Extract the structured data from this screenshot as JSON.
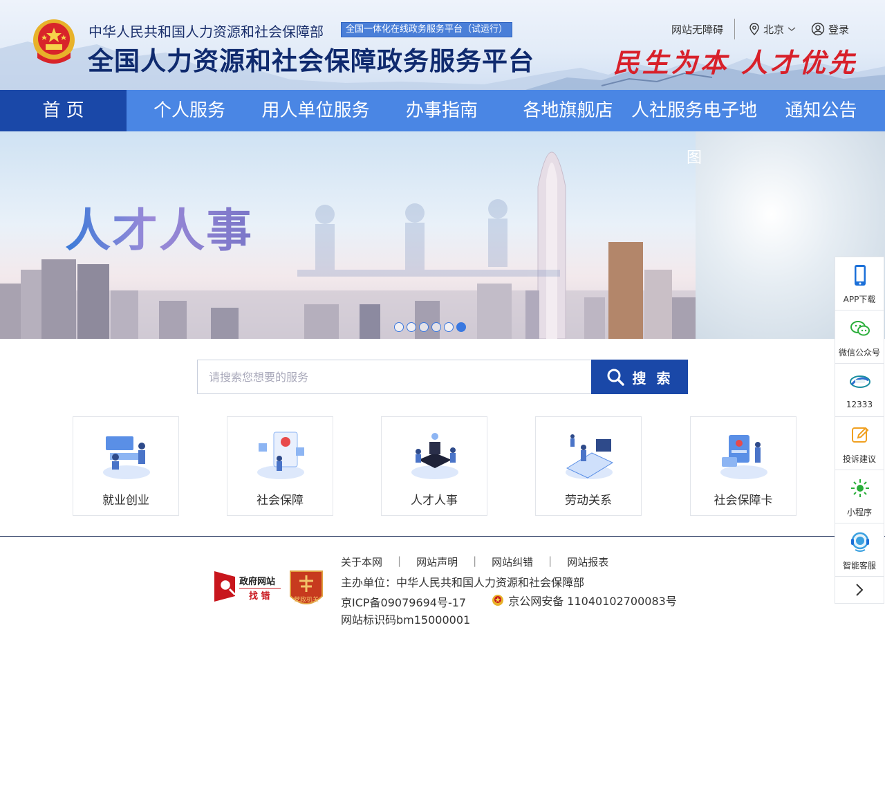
{
  "header": {
    "ministry": "中华人民共和国人力资源和社会保障部",
    "trial_badge": "全国一体化在线政务服务平台（试运行）",
    "platform": "全国人力资源和社会保障政务服务平台",
    "accessibility": "网站无障碍",
    "location": "北京",
    "login": "登录",
    "slogan": "民生为本 人才优先"
  },
  "nav": [
    {
      "label": "首 页",
      "active": true
    },
    {
      "label": "个人服务"
    },
    {
      "label": "用人单位服务"
    },
    {
      "label": "办事指南"
    },
    {
      "label": "各地旗舰店"
    },
    {
      "label": "人社服务电子地"
    },
    {
      "label": "通知公告"
    }
  ],
  "banner": {
    "title": "人才人事",
    "broken_image": "图",
    "slide_count": 6,
    "active_slide": 6
  },
  "search": {
    "placeholder": "请搜索您想要的服务",
    "value": "",
    "button": "搜 索"
  },
  "services": [
    {
      "label": "就业创业",
      "icon": "employment-icon"
    },
    {
      "label": "社会保障",
      "icon": "social-security-icon"
    },
    {
      "label": "人才人事",
      "icon": "talent-icon"
    },
    {
      "label": "劳动关系",
      "icon": "labor-relations-icon"
    },
    {
      "label": "社会保障卡",
      "icon": "social-security-card-icon"
    }
  ],
  "footer": {
    "links": [
      "关于本网",
      "网站声明",
      "网站纠错",
      "网站报表"
    ],
    "host": "主办单位：中华人民共和国人力资源和社会保障部",
    "icp": "京ICP备09079694号-17",
    "police": "京公网安备 11040102700083号",
    "site_code": "网站标识码bm15000001",
    "find_error": {
      "line1": "政府网站",
      "line2": "找 错"
    },
    "party": "党政机关"
  },
  "sidebar": [
    {
      "label": "APP下载",
      "icon": "phone-icon"
    },
    {
      "label": "微信公众号",
      "icon": "wechat-icon"
    },
    {
      "label": "12333",
      "icon": "hotline-12333-icon"
    },
    {
      "label": "投诉建议",
      "icon": "edit-icon"
    },
    {
      "label": "小程序",
      "icon": "mini-program-icon"
    },
    {
      "label": "智能客服",
      "icon": "headset-icon"
    }
  ],
  "colors": {
    "primary": "#1a48a8",
    "nav": "#4a86e4",
    "slogan": "#d8202a",
    "accent": "#f0a020"
  }
}
